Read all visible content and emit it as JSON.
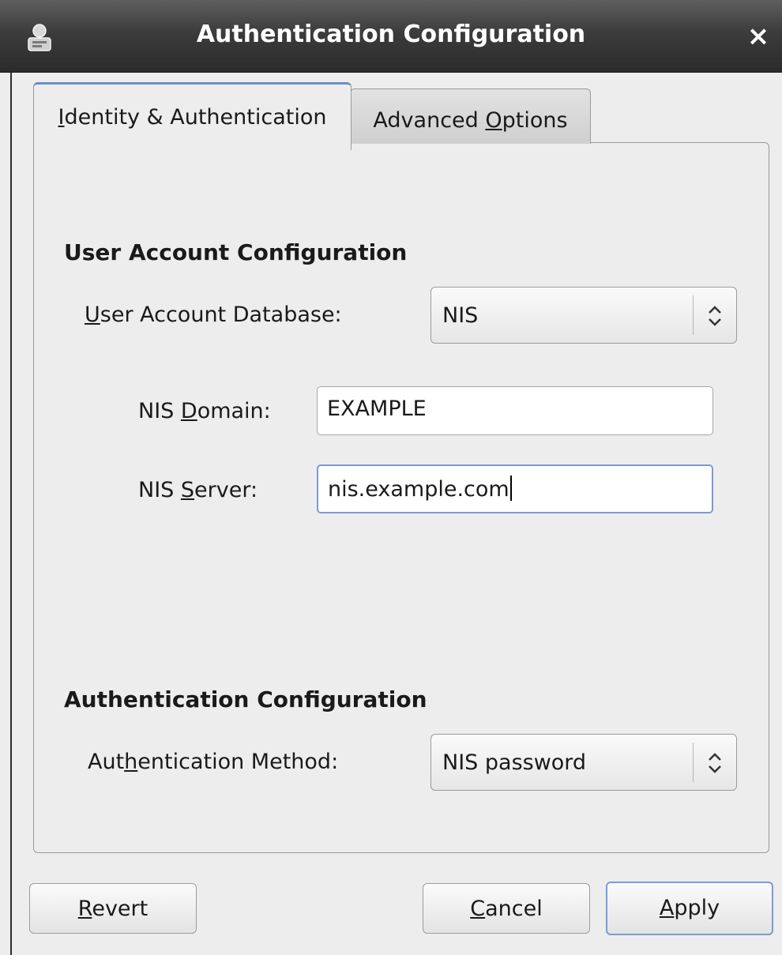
{
  "window": {
    "title": "Authentication Configuration",
    "close_glyph": "×",
    "title_icon": "authentication-app-icon"
  },
  "tabs": [
    {
      "pre": "",
      "mnemonic": "I",
      "post": "dentity & Authentication",
      "active": true
    },
    {
      "pre": "Advanced ",
      "mnemonic": "O",
      "post": "ptions",
      "active": false
    }
  ],
  "user_account": {
    "section_title": "User Account Configuration",
    "database_label": {
      "pre": "",
      "mnemonic": "U",
      "post": "ser Account Database:"
    },
    "database_value": "NIS",
    "domain_label": {
      "pre": "NIS ",
      "mnemonic": "D",
      "post": "omain:"
    },
    "domain_value": "EXAMPLE",
    "server_label": {
      "pre": "NIS ",
      "mnemonic": "S",
      "post": "erver:"
    },
    "server_value": "nis.example.com"
  },
  "authentication": {
    "section_title": "Authentication Configuration",
    "method_label": {
      "pre": "Aut",
      "mnemonic": "h",
      "post": "entication Method:"
    },
    "method_value": "NIS password"
  },
  "buttons": {
    "revert": {
      "pre": "",
      "mnemonic": "R",
      "post": "evert"
    },
    "cancel": {
      "pre": "",
      "mnemonic": "C",
      "post": "ancel"
    },
    "apply": {
      "pre": "",
      "mnemonic": "A",
      "post": "pply"
    }
  }
}
